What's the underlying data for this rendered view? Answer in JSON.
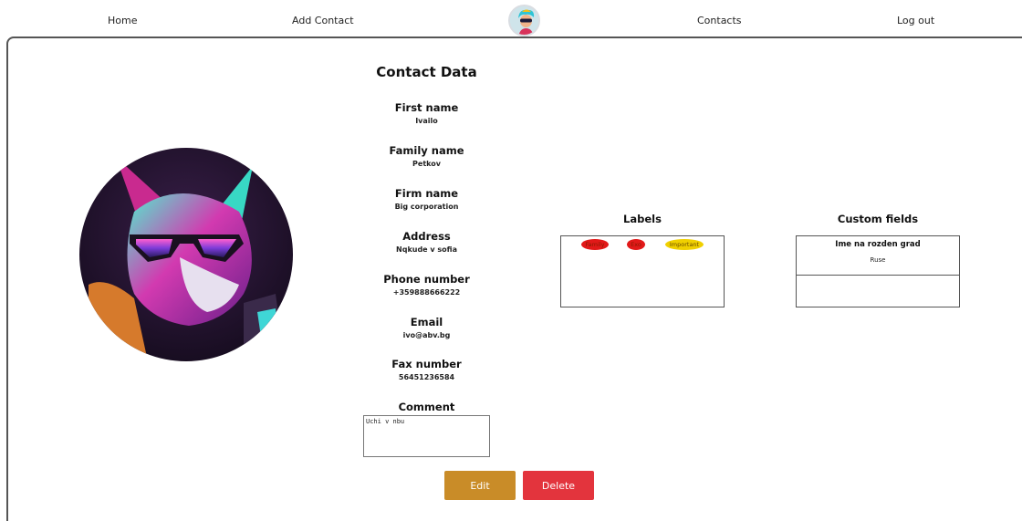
{
  "nav": {
    "home": "Home",
    "add_contact": "Add Contact",
    "contacts": "Contacts",
    "log_out": "Log out"
  },
  "contact": {
    "title": "Contact Data",
    "fields": [
      {
        "label": "First name",
        "value": "Ivailo"
      },
      {
        "label": "Family name",
        "value": "Petkov"
      },
      {
        "label": "Firm name",
        "value": "Big corporation"
      },
      {
        "label": "Address",
        "value": "Nqkude v sofia"
      },
      {
        "label": "Phone number",
        "value": "+359888666222"
      },
      {
        "label": "Email",
        "value": "ivo@abv.bg"
      },
      {
        "label": "Fax number",
        "value": "56451236584"
      }
    ],
    "comment_label": "Comment",
    "comment_value": "Uchi v nbu"
  },
  "labels": {
    "title": "Labels",
    "items": [
      {
        "text": "Family",
        "color": "#e21919"
      },
      {
        "text": "Exo",
        "color": "#e21919"
      },
      {
        "text": "Important",
        "color": "#f0d000"
      }
    ]
  },
  "custom_fields": {
    "title": "Custom fields",
    "items": [
      {
        "key": "Ime na rozden grad",
        "value": "Ruse"
      }
    ]
  },
  "actions": {
    "edit": "Edit",
    "delete": "Delete"
  },
  "colors": {
    "edit_button": "#c98c28",
    "delete_button": "#e3343d"
  }
}
